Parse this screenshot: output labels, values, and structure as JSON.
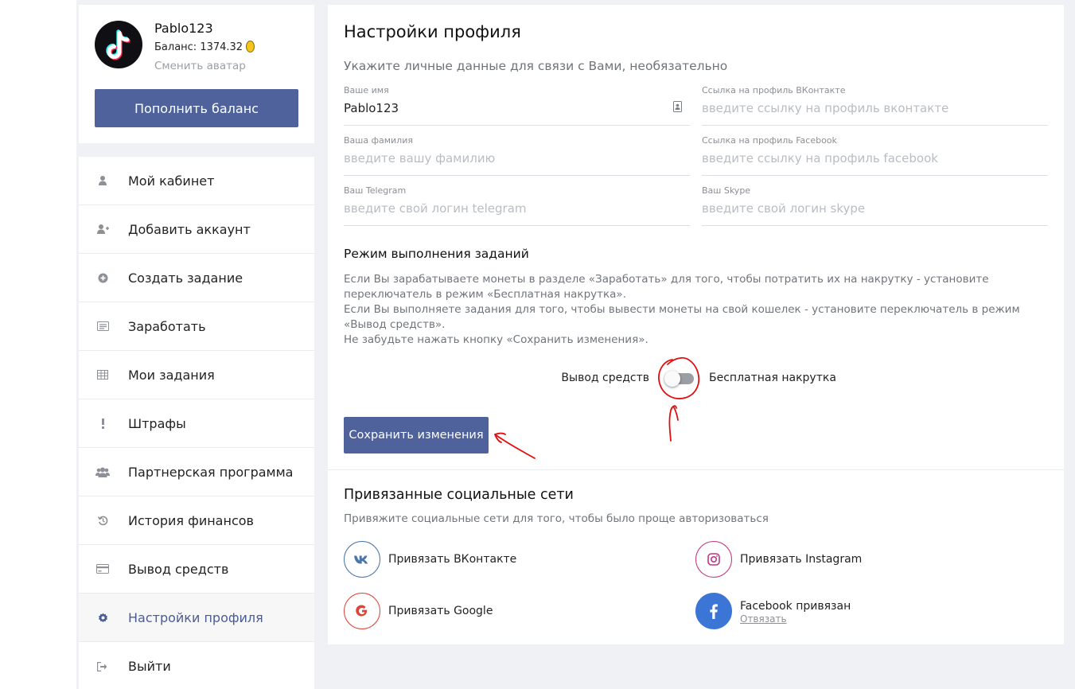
{
  "profile": {
    "username": "Pablo123",
    "balance": "Баланс: 1374.32",
    "change_avatar": "Сменить аватар",
    "topup_button": "Пополнить баланс"
  },
  "nav": {
    "items": [
      {
        "label": "Мой кабинет",
        "icon": "user-icon"
      },
      {
        "label": "Добавить аккаунт",
        "icon": "user-plus-icon"
      },
      {
        "label": "Создать задание",
        "icon": "plus-circle-icon"
      },
      {
        "label": "Заработать",
        "icon": "list-icon"
      },
      {
        "label": "Мои задания",
        "icon": "table-icon"
      },
      {
        "label": "Штрафы",
        "icon": "exclamation-icon"
      },
      {
        "label": "Партнерская программа",
        "icon": "users-icon"
      },
      {
        "label": "История финансов",
        "icon": "history-icon"
      },
      {
        "label": "Вывод средств",
        "icon": "credit-card-icon"
      },
      {
        "label": "Настройки профиля",
        "icon": "gear-icon",
        "active": true
      },
      {
        "label": "Выйти",
        "icon": "logout-icon"
      }
    ]
  },
  "main": {
    "title": "Настройки профиля",
    "subtitle": "Укажите личные данные для связи с Вами, необязательно",
    "fields": {
      "name": {
        "label": "Ваше имя",
        "value": "Pablo123",
        "placeholder": ""
      },
      "vk": {
        "label": "Ссылка на профиль ВКонтакте",
        "value": "",
        "placeholder": "введите ссылку на профиль вконтакте"
      },
      "surname": {
        "label": "Ваша фамилия",
        "value": "",
        "placeholder": "введите вашу фамилию"
      },
      "facebook": {
        "label": "Ссылка на профиль Facebook",
        "value": "",
        "placeholder": "введите ссылку на профиль facebook"
      },
      "telegram": {
        "label": "Ваш Telegram",
        "value": "",
        "placeholder": "введите свой логин telegram"
      },
      "skype": {
        "label": "Ваш Skype",
        "value": "",
        "placeholder": "введите свой логин skype"
      }
    },
    "mode": {
      "title": "Режим выполнения заданий",
      "line1": "Если Вы зарабатываете монеты в разделе «Заработать» для того, чтобы потратить их на накрутку - установите переключатель в режим «Бесплатная накрутка».",
      "line2": "Если Вы выполняете задания для того, чтобы вывести монеты на свой кошелек - установите переключатель в режим «Вывод средств».",
      "line3": "Не забудьте нажать кнопку «Сохранить изменения».",
      "left_label": "Вывод средств",
      "right_label": "Бесплатная накрутка",
      "toggle_state": "Вывод средств"
    },
    "save_button": "Сохранить изменения",
    "social": {
      "title": "Привязанные социальные сети",
      "subtitle": "Привяжите социальные сети для того, чтобы было проще авторизоваться",
      "vk": "Привязать ВКонтакте",
      "instagram": "Привязать Instagram",
      "google": "Привязать Google",
      "facebook": "Facebook привязан",
      "facebook_unlink": "Отвязать"
    }
  },
  "colors": {
    "accent": "#4f629b",
    "active_nav": "#4a5c94",
    "vk": "#4a76a8",
    "instagram": "#c13584",
    "google": "#db4437",
    "facebook": "#3b76d6",
    "annotation": "#e01010"
  }
}
